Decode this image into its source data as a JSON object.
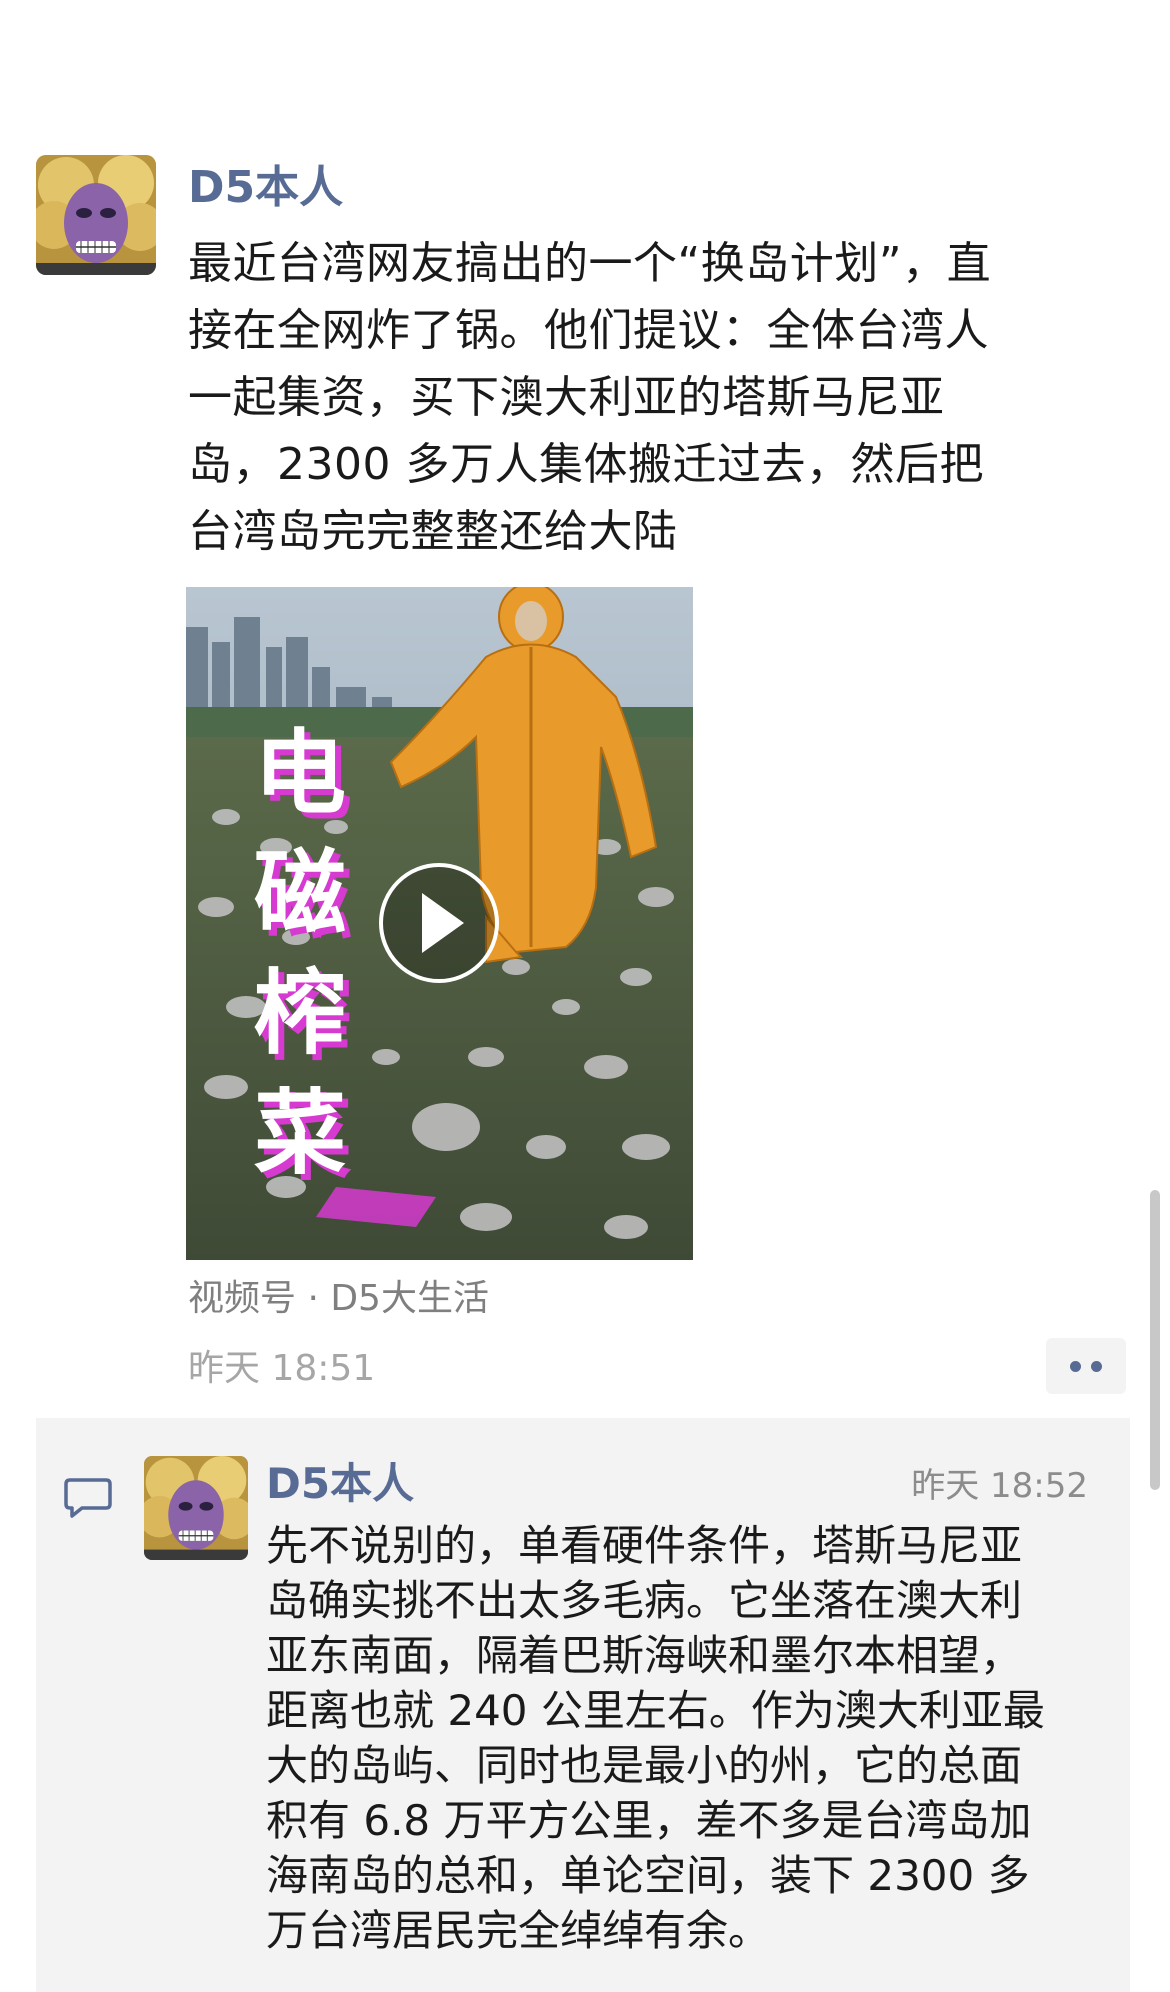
{
  "post": {
    "author": "D5本人",
    "body_lines": [
      "最近台湾网友搞出的一个“换岛计划”，直",
      "接在全网炸了锅。他们提议：全体台湾人",
      "一起集资，买下澳大利亚的塔斯马尼亚",
      "岛，2300 多万人集体搬迁过去，然后把",
      "台湾岛完完整整还给大陆"
    ],
    "video": {
      "overlay_text": "电磁榨菜",
      "icon": "play-icon"
    },
    "channel_source": "视频号 · D5大生活",
    "time": "昨天 18:51",
    "more_icon": "ellipsis-icon"
  },
  "comment": {
    "icon": "comment-icon",
    "author": "D5本人",
    "time": "昨天 18:52",
    "body_lines": [
      "先不说别的，单看硬件条件，塔斯马尼亚",
      "岛确实挑不出太多毛病。它坐落在澳大利",
      "亚东南面，隔着巴斯海峡和墨尔本相望，",
      "距离也就 240 公里左右。作为澳大利亚最",
      "大的岛屿、同时也是最小的州，它的总面",
      "积有 6.8 万平方公里，差不多是台湾岛加",
      "海南岛的总和，单论空间，装下 2300 多",
      "万台湾居民完全绰绰有余。"
    ]
  },
  "colors": {
    "name_blue": "#576b95",
    "meta_gray": "#a6a6a6",
    "panel_bg": "#f3f3f3",
    "suit_orange": "#e89a2a",
    "overlay_magenta": "#d63ad0"
  }
}
